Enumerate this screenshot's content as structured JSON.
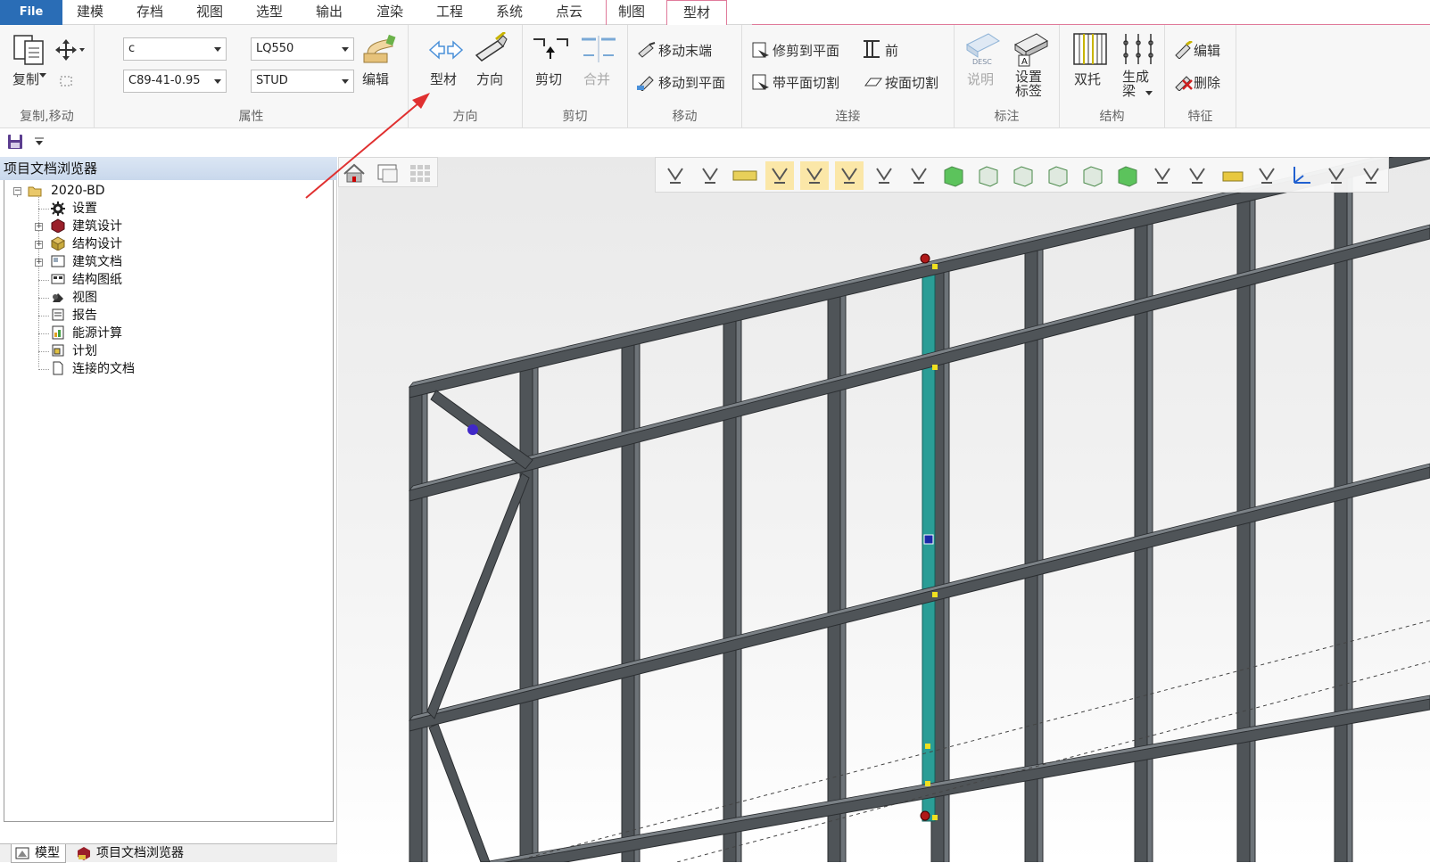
{
  "menubar": {
    "file_label": "File",
    "tabs": [
      {
        "label": "建模"
      },
      {
        "label": "存档"
      },
      {
        "label": "视图"
      },
      {
        "label": "选型"
      },
      {
        "label": "输出"
      },
      {
        "label": "渲染"
      },
      {
        "label": "工程"
      },
      {
        "label": "系统"
      },
      {
        "label": "点云"
      },
      {
        "label": "制图"
      },
      {
        "label": "型材"
      }
    ],
    "active_tab": "型材"
  },
  "ribbon": {
    "groups": {
      "copy_move": {
        "label": "复制,移动",
        "copy_label": "复制"
      },
      "properties": {
        "label": "属性",
        "profile_type": "c",
        "material": "LQ550",
        "section": "C89-41-0.95",
        "member_type": "STUD",
        "edit_label": "编辑"
      },
      "direction": {
        "label": "方向",
        "profile_label": "型材",
        "direction_label": "方向"
      },
      "cut": {
        "label": "剪切",
        "cut_label": "剪切",
        "merge_label": "合并"
      },
      "move": {
        "label": "移动",
        "move_end_label": "移动末端",
        "move_to_plane_label": "移动到平面"
      },
      "connect": {
        "label": "连接",
        "trim_to_plane_label": "修剪到平面",
        "front_label": "前",
        "cut_with_plane_label": "带平面切割",
        "cut_by_plane_label": "按面切割"
      },
      "annotate": {
        "label": "标注",
        "description_label": "说明",
        "set_label_line1": "设置",
        "set_label_line2": "标签",
        "desc_icon_text": "DESC"
      },
      "structure": {
        "label": "结构",
        "double_label": "双托",
        "generate_beam_line1": "生成",
        "generate_beam_line2": "梁"
      },
      "feature": {
        "label": "特征",
        "edit_label": "编辑",
        "delete_label": "删除"
      }
    }
  },
  "left_panel": {
    "title": "项目文档浏览器",
    "root": "2020-BD",
    "items": [
      {
        "label": "设置",
        "icon": "gear-icon",
        "expandable": false
      },
      {
        "label": "建筑设计",
        "icon": "house-cube-icon",
        "expandable": true
      },
      {
        "label": "结构设计",
        "icon": "cube-icon",
        "expandable": true
      },
      {
        "label": "建筑文档",
        "icon": "document-image-icon",
        "expandable": true
      },
      {
        "label": "结构图纸",
        "icon": "drawing-icon",
        "expandable": false
      },
      {
        "label": "视图",
        "icon": "camera-icon",
        "expandable": false
      },
      {
        "label": "报告",
        "icon": "report-icon",
        "expandable": false
      },
      {
        "label": "能源计算",
        "icon": "energy-icon",
        "expandable": false
      },
      {
        "label": "计划",
        "icon": "schedule-icon",
        "expandable": false
      },
      {
        "label": "连接的文档",
        "icon": "blank-document-icon",
        "expandable": false
      }
    ],
    "bottom_tabs": [
      {
        "label": "模型"
      },
      {
        "label": "项目文档浏览器"
      }
    ]
  },
  "colors": {
    "file_tab": "#2a6db6",
    "active_tab_border": "#e07a9a",
    "steel_member": "#4f5458",
    "selected_member": "#2a9d96",
    "annotation_arrow": "#e03030"
  }
}
